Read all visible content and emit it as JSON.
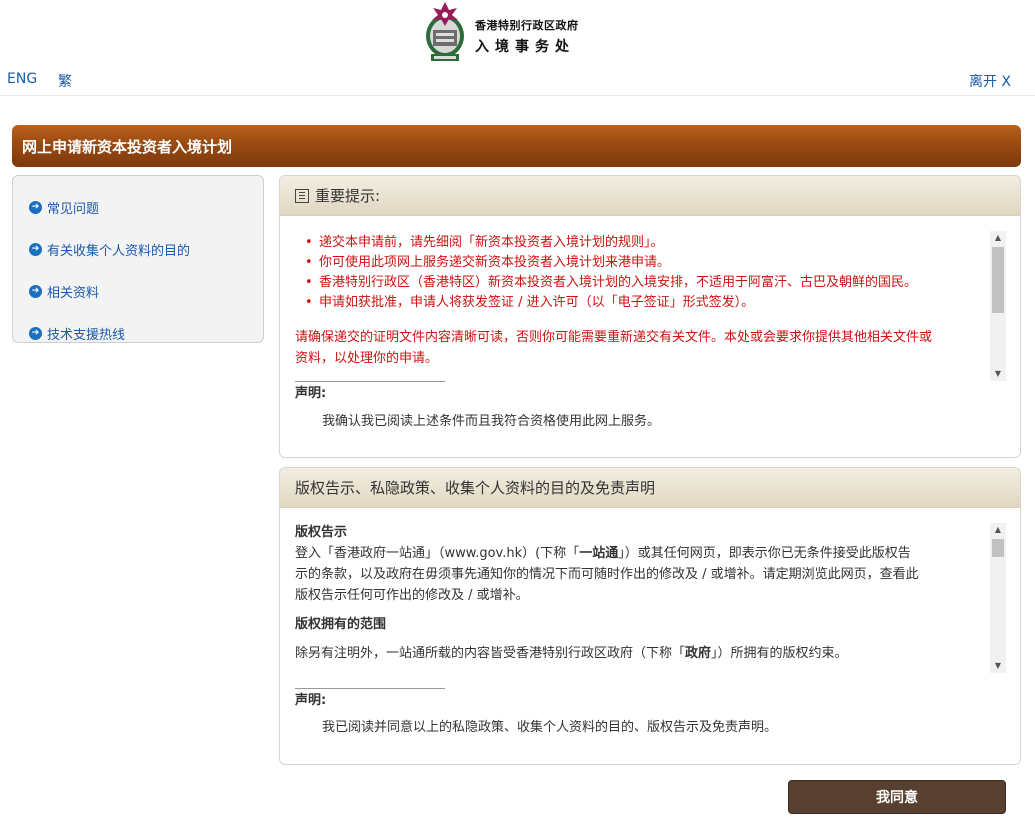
{
  "header": {
    "gov_name": "香港特别行政区政府",
    "dept_name": "入境事务处",
    "lang_eng": "ENG",
    "lang_tc": "繁",
    "exit": "离开 X"
  },
  "title": "网上申请新资本投资者入境计划",
  "sidebar": {
    "items": [
      {
        "label": "常见问题"
      },
      {
        "label": "有关收集个人资料的目的"
      },
      {
        "label": "相关资料"
      },
      {
        "label": "技术支援热线"
      }
    ]
  },
  "important": {
    "heading": "重要提示:",
    "bullets": [
      "递交本申请前，请先细阅「新资本投资者入境计划的规则」。",
      "你可使用此项网上服务递交新资本投资者入境计划来港申请。",
      "香港特别行政区（香港特区）新资本投资者入境计划的入境安排，不适用于阿富汗、古巴及朝鲜的国民。",
      "申请如获批准，申请人将获发签证 / 进入许可（以「电子签证」形式签发）。"
    ],
    "note_line1": "请确保递交的证明文件内容清晰可读，否则你可能需要重新递交有关文件。本处或会要求你提供其他相关文件或",
    "note_line2": "资料，以处理你的申请。",
    "declaration_label": "声明:",
    "declaration_text": "我确认我已阅读上述条件而且我符合资格使用此网上服务。"
  },
  "copyright": {
    "heading": "版权告示、私隐政策、收集个人资料的目的及免责声明",
    "sub1": "版权告示",
    "p1_line1_a": "登入「香港政府一站通」（www.gov.hk）(下称「",
    "p1_line1_bold": "一站通",
    "p1_line1_b": "」）或其任何网页，即表示你已无条件接受此版权告",
    "p1_line2": "示的条款，以及政府在毋须事先通知你的情况下而可随时作出的修改及 / 或增补。请定期浏览此网页，查看此",
    "p1_line3": "版权告示任何可作出的修改及 / 或增补。",
    "sub2": "版权拥有的范围",
    "p2_a": "除另有注明外，一站通所载的内容皆受香港特别行政区政府（下称「",
    "p2_bold": "政府",
    "p2_b": "」）所拥有的版权约束。",
    "declaration_label": "声明:",
    "declaration_text": "我已阅读并同意以上的私隐政策、收集个人资料的目的、版权告示及免责声明。"
  },
  "agree_button": "我同意"
}
